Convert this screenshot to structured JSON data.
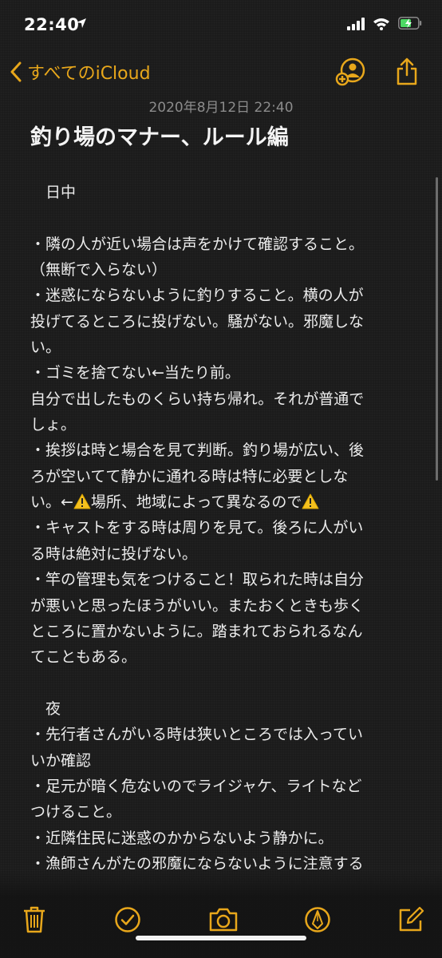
{
  "status": {
    "time": "22:40"
  },
  "nav": {
    "back_label": "すべてのiCloud"
  },
  "note": {
    "date": "2020年8月12日 22:40",
    "title": "釣り場のマナー、ルール編",
    "lines": [
      "　日中",
      "",
      "・隣の人が近い場合は声をかけて確認すること。",
      "（無断で入らない）",
      "・迷惑にならないように釣りすること。横の人が",
      "投げてるところに投げない。騒がない。邪魔しな",
      "い。",
      "・ゴミを捨てない←当たり前。",
      "自分で出したものくらい持ち帰れ。それが普通で",
      "しょ。",
      "・挨拶は時と場合を見て判断。釣り場が広い、後",
      "ろが空いてて静かに通れる時は特に必要としな",
      "",
      "・キャストをする時は周りを見て。後ろに人がい",
      "る時は絶対に投げない。",
      "・竿の管理も気をつけること！取られた時は自分",
      "が悪いと思ったほうがいい。またおくときも歩く",
      "ところに置かないように。踏まれておられるなん",
      "てこともある。",
      "",
      "　夜",
      "・先行者さんがいる時は狭いところでは入ってい",
      "いか確認",
      "・足元が暗く危ないのでライジャケ、ライトなど",
      "つけること。",
      "・近隣住民に迷惑のかからないよう静かに。",
      "・漁師さんがたの邪魔にならないように注意する"
    ],
    "warning_line": {
      "part1": "い。←",
      "part2": "場所、地域によって異なるので"
    }
  },
  "colors": {
    "accent": "#e8a71b",
    "background": "#1b1b1b",
    "text": "#ececec"
  }
}
